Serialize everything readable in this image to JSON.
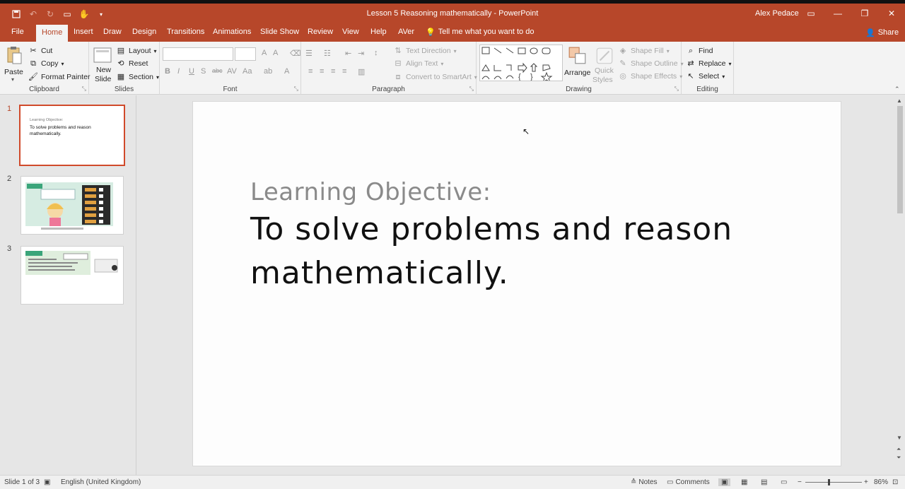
{
  "window": {
    "title": "Lesson 5 Reasoning mathematically  -  PowerPoint",
    "user": "Alex Pedace"
  },
  "tabs": [
    "File",
    "Home",
    "Insert",
    "Draw",
    "Design",
    "Transitions",
    "Animations",
    "Slide Show",
    "Review",
    "View",
    "Help",
    "AVer"
  ],
  "active_tab": "Home",
  "tell_me": "Tell me what you want to do",
  "share": "Share",
  "ribbon": {
    "clipboard": {
      "label": "Clipboard",
      "paste": "Paste",
      "cut": "Cut",
      "copy": "Copy",
      "format_painter": "Format Painter"
    },
    "slides": {
      "label": "Slides",
      "new_slide_1": "New",
      "new_slide_2": "Slide",
      "layout": "Layout",
      "reset": "Reset",
      "section": "Section"
    },
    "font": {
      "label": "Font"
    },
    "paragraph": {
      "label": "Paragraph",
      "text_direction": "Text Direction",
      "align_text": "Align Text",
      "convert_smartart": "Convert to SmartArt"
    },
    "drawing": {
      "label": "Drawing",
      "arrange": "Arrange",
      "quick_styles_1": "Quick",
      "quick_styles_2": "Styles",
      "shape_fill": "Shape Fill",
      "shape_outline": "Shape Outline",
      "shape_effects": "Shape Effects"
    },
    "editing": {
      "label": "Editing",
      "find": "Find",
      "replace": "Replace",
      "select": "Select"
    }
  },
  "thumbnails": [
    {
      "number": "1",
      "small": "Learning Objective:",
      "big": "To solve problems and reason mathematically."
    },
    {
      "number": "2"
    },
    {
      "number": "3"
    }
  ],
  "slide": {
    "label": "Learning Objective:",
    "text": "To solve problems and reason mathematically."
  },
  "status": {
    "slide_info": "Slide 1 of 3",
    "language": "English (United Kingdom)",
    "notes": "Notes",
    "comments": "Comments",
    "zoom": "86%"
  },
  "colors": {
    "accent": "#b7472a",
    "selection": "#d04a2b"
  }
}
